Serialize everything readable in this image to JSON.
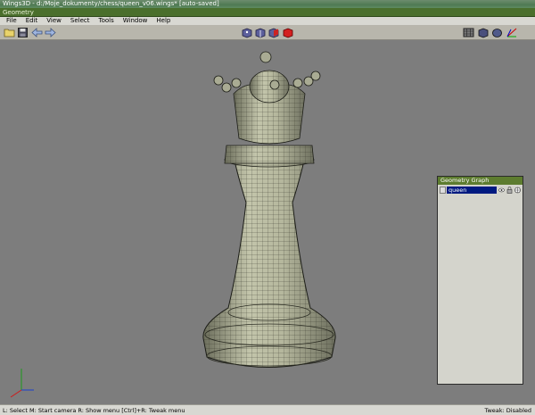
{
  "window": {
    "title": "Wings3D - d:/Moje_dokumenty/chess/queen_v06.wings* [auto-saved]"
  },
  "caption": {
    "title": "Geometry"
  },
  "menu": [
    "File",
    "Edit",
    "View",
    "Select",
    "Tools",
    "Window",
    "Help"
  ],
  "toolbar": {
    "left_icons": [
      "open-folder-icon",
      "save-icon",
      "undo-arrow-icon",
      "redo-arrow-icon"
    ],
    "selection_modes": [
      "vertex-mode-icon",
      "edge-mode-icon",
      "face-mode-icon",
      "body-mode-icon"
    ],
    "right_icons": [
      "grid-view-icon",
      "shaded-view-icon",
      "smooth-view-icon",
      "axes-icon"
    ]
  },
  "geometry_graph": {
    "title": "Geometry Graph",
    "object": "queen"
  },
  "status": {
    "left": "L: Select   M: Start camera   R: Show menu   [Ctrl]+R: Tweak menu",
    "right": "Tweak: Disabled"
  },
  "colors": {
    "accent": "#4a6f2c",
    "selection": "#001a80",
    "model_face": "#b9bba3",
    "viewport": "#7d7d7d"
  }
}
